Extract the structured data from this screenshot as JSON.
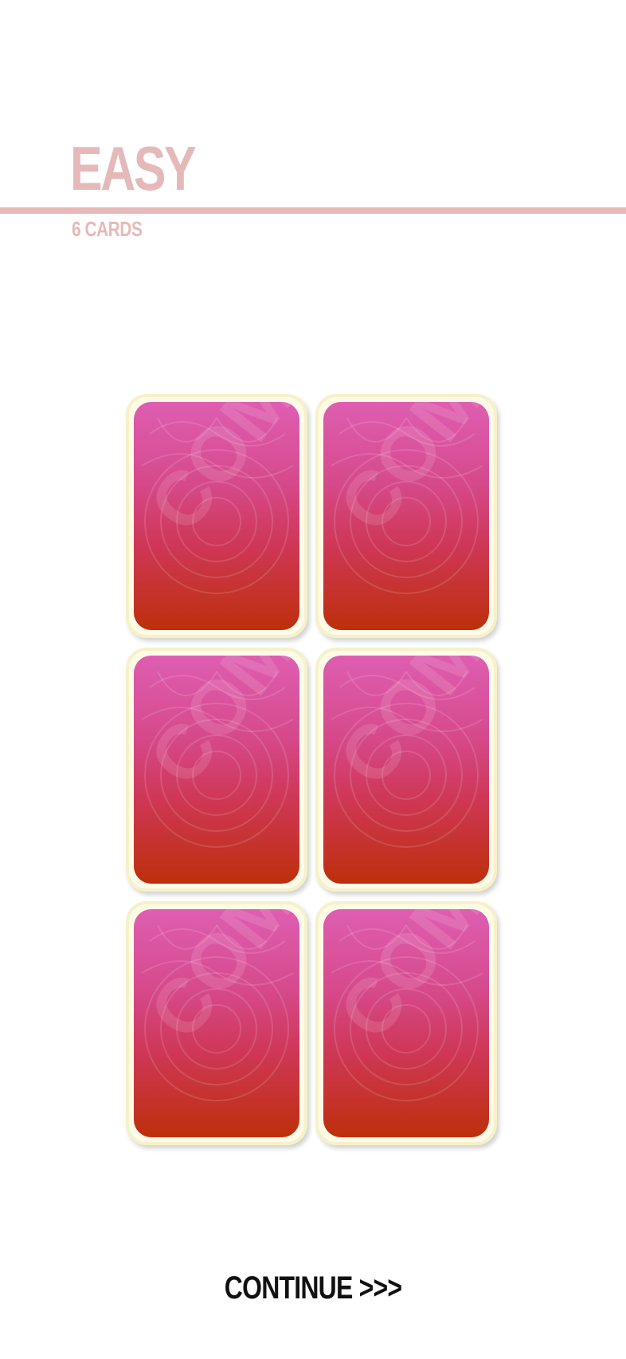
{
  "level": {
    "title": "EASY",
    "subtitle": "6 CARDS"
  },
  "cards": [
    {
      "state": "face-down",
      "watermark": "COMIR"
    },
    {
      "state": "face-down",
      "watermark": "COMIR"
    },
    {
      "state": "face-down",
      "watermark": "COMIR"
    },
    {
      "state": "face-down",
      "watermark": "COMIR"
    },
    {
      "state": "face-down",
      "watermark": "COMIR"
    },
    {
      "state": "face-down",
      "watermark": "COMIR"
    }
  ],
  "continue": {
    "label": "CONTINUE >>>"
  },
  "colors": {
    "accent": "#e5b9b9",
    "card_top": "#de5eb1",
    "card_bottom": "#bd2f0b",
    "card_border": "#f6f1c8",
    "button_text": "#111111"
  }
}
